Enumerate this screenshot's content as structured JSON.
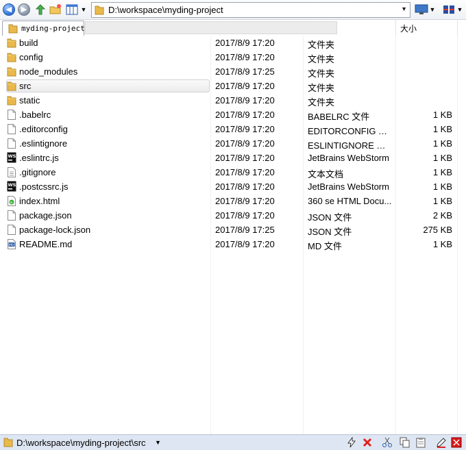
{
  "address": {
    "path": "D:\\workspace\\myding-project"
  },
  "tab": {
    "label": "myding-project"
  },
  "header": {
    "size_label": "大小"
  },
  "rows": [
    {
      "name": "build",
      "date": "2017/8/9 17:20",
      "type": "文件夹",
      "size": "",
      "icon": "folder-icon"
    },
    {
      "name": "config",
      "date": "2017/8/9 17:20",
      "type": "文件夹",
      "size": "",
      "icon": "folder-icon"
    },
    {
      "name": "node_modules",
      "date": "2017/8/9 17:25",
      "type": "文件夹",
      "size": "",
      "icon": "folder-icon"
    },
    {
      "name": "src",
      "date": "2017/8/9 17:20",
      "type": "文件夹",
      "size": "",
      "icon": "folder-icon"
    },
    {
      "name": "static",
      "date": "2017/8/9 17:20",
      "type": "文件夹",
      "size": "",
      "icon": "folder-icon"
    },
    {
      "name": ".babelrc",
      "date": "2017/8/9 17:20",
      "type": "BABELRC 文件",
      "size": "1 KB",
      "icon": "file-icon"
    },
    {
      "name": ".editorconfig",
      "date": "2017/8/9 17:20",
      "type": "EDITORCONFIG 文件",
      "size": "1 KB",
      "icon": "file-icon"
    },
    {
      "name": ".eslintignore",
      "date": "2017/8/9 17:20",
      "type": "ESLINTIGNORE 文件",
      "size": "1 KB",
      "icon": "file-icon"
    },
    {
      "name": ".eslintrc.js",
      "date": "2017/8/9 17:20",
      "type": "JetBrains WebStorm",
      "size": "1 KB",
      "icon": "webstorm-icon"
    },
    {
      "name": ".gitignore",
      "date": "2017/8/9 17:20",
      "type": "文本文档",
      "size": "1 KB",
      "icon": "text-file-icon"
    },
    {
      "name": ".postcssrc.js",
      "date": "2017/8/9 17:20",
      "type": "JetBrains WebStorm",
      "size": "1 KB",
      "icon": "webstorm-icon"
    },
    {
      "name": "index.html",
      "date": "2017/8/9 17:20",
      "type": "360 se HTML Docu...",
      "size": "1 KB",
      "icon": "html-file-icon"
    },
    {
      "name": "package.json",
      "date": "2017/8/9 17:20",
      "type": "JSON 文件",
      "size": "2 KB",
      "icon": "file-icon"
    },
    {
      "name": "package-lock.json",
      "date": "2017/8/9 17:25",
      "type": "JSON 文件",
      "size": "275 KB",
      "icon": "file-icon"
    },
    {
      "name": "README.md",
      "date": "2017/8/9 17:20",
      "type": "MD 文件",
      "size": "1 KB",
      "icon": "markdown-file-icon"
    }
  ],
  "selected_row": "src",
  "status": {
    "path": "D:\\workspace\\myding-project\\src"
  },
  "toolbar_icons": [
    "back-icon",
    "forward-icon",
    "up-folder-icon",
    "new-folder-icon",
    "view-mode-icon",
    "view-dropdown-icon"
  ],
  "status_icons": [
    "lightning-icon",
    "delete-icon",
    "cut-icon",
    "copy-icon",
    "paste-icon",
    "edit-icon",
    "close-panel-icon"
  ],
  "colors": {
    "status_bg": "#dde6f2",
    "folder": "#e8b84a",
    "selection_border": "#cfd3d8"
  }
}
